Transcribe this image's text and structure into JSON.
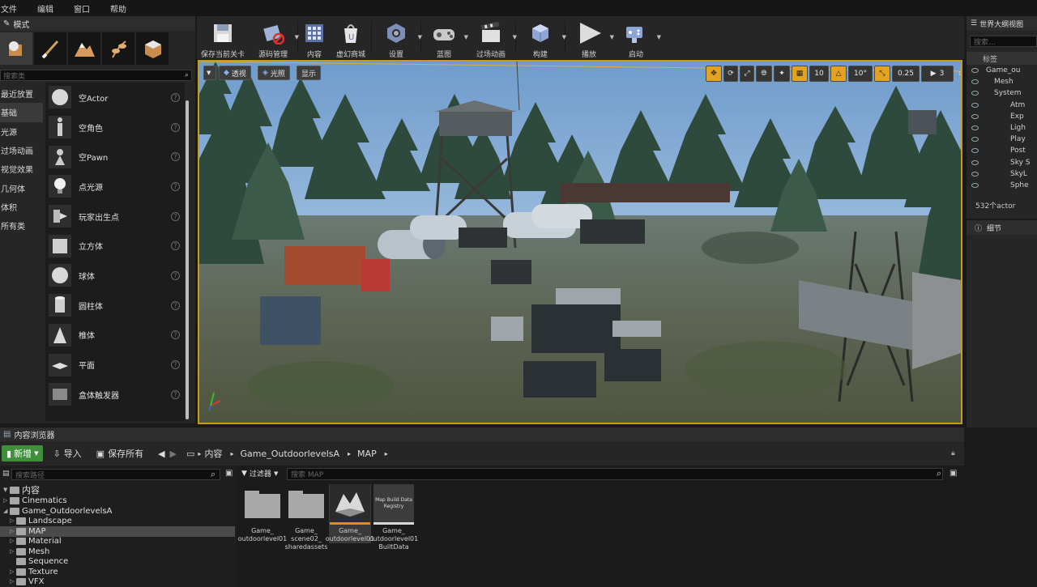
{
  "menu": {
    "items": [
      "文件",
      "编辑",
      "窗口",
      "帮助"
    ]
  },
  "modes": {
    "tab_label": "模式",
    "search_placeholder": "搜索类",
    "categories": [
      "最近放置",
      "基础",
      "光源",
      "过场动画",
      "视觉效果",
      "几何体",
      "体积",
      "所有类"
    ],
    "active_category": "基础",
    "items": [
      {
        "label": "空Actor",
        "icon": "sphere-icon"
      },
      {
        "label": "空角色",
        "icon": "character-icon"
      },
      {
        "label": "空Pawn",
        "icon": "pawn-icon"
      },
      {
        "label": "点光源",
        "icon": "light-bulb-icon"
      },
      {
        "label": "玩家出生点",
        "icon": "player-start-icon"
      },
      {
        "label": "立方体",
        "icon": "cube-icon"
      },
      {
        "label": "球体",
        "icon": "sphere-icon"
      },
      {
        "label": "圆柱体",
        "icon": "cylinder-icon"
      },
      {
        "label": "椎体",
        "icon": "cone-icon"
      },
      {
        "label": "平面",
        "icon": "plane-icon"
      },
      {
        "label": "盒体触发器",
        "icon": "box-trigger-icon"
      }
    ]
  },
  "toolbar": {
    "buttons": [
      {
        "label": "保存当前关卡",
        "icon": "save-icon"
      },
      {
        "label": "源码管理",
        "icon": "source-control-icon"
      },
      {
        "label": "内容",
        "icon": "content-icon"
      },
      {
        "label": "虚幻商城",
        "icon": "marketplace-icon"
      },
      {
        "label": "设置",
        "icon": "settings-icon"
      },
      {
        "label": "蓝图",
        "icon": "blueprint-icon"
      },
      {
        "label": "过场动画",
        "icon": "cinematics-icon"
      },
      {
        "label": "构建",
        "icon": "build-icon"
      },
      {
        "label": "播放",
        "icon": "play-icon"
      },
      {
        "label": "启动",
        "icon": "launch-icon"
      }
    ]
  },
  "viewport": {
    "perspective_label": "透视",
    "lit_label": "光照",
    "show_label": "显示",
    "grid_snap": "10",
    "rotation_snap": "10°",
    "scale_snap": "0.25",
    "camera_speed": "3"
  },
  "outliner": {
    "tab_label": "世界大纲视图",
    "search_placeholder": "搜索...",
    "column_label": "标签",
    "rows": [
      "Game_ou",
      "Mesh",
      "System",
      "Atm",
      "Exp",
      "Ligh",
      "Play",
      "Post",
      "Sky S",
      "SkyL",
      "Sphe"
    ],
    "count": "532个actor"
  },
  "details": {
    "tab_label": "细节"
  },
  "content_browser": {
    "tab_label": "内容浏览器",
    "add_label": "新增",
    "import_label": "导入",
    "save_all_label": "保存所有",
    "path": [
      "内容",
      "Game_OutdoorlevelsA",
      "MAP"
    ],
    "search_path_placeholder": "搜索路径",
    "filter_label": "过滤器",
    "search_placeholder": "搜索 MAP",
    "tree": [
      "内容",
      "Cinematics",
      "Game_OutdoorlevelsA",
      "Landscape",
      "MAP",
      "Material",
      "Mesh",
      "Sequence",
      "Texture",
      "VFX"
    ],
    "assets": [
      {
        "name": "Game_outdoorlevel01",
        "type": "folder"
      },
      {
        "name": "Game_scene02_sharedassets",
        "type": "folder"
      },
      {
        "name": "Game_outdoorlevel01",
        "type": "level"
      },
      {
        "name": "Game_outdoorlevel01_BuiltData",
        "type": "map-build-data",
        "thumb_text": "Map Build Data Registry"
      }
    ],
    "asset_lines": [
      [
        "Game_",
        "outdoorlevel01"
      ],
      [
        "Game_",
        "scene02_",
        "sharedassets"
      ],
      [
        "Game_",
        "outdoorlevel01"
      ],
      [
        "Game_",
        "outdoorlevel01",
        "BuiltData"
      ]
    ]
  },
  "colors": {
    "accent_green": "#3f8f3b",
    "viewport_border": "#c79a1a",
    "panel": "#262626"
  }
}
